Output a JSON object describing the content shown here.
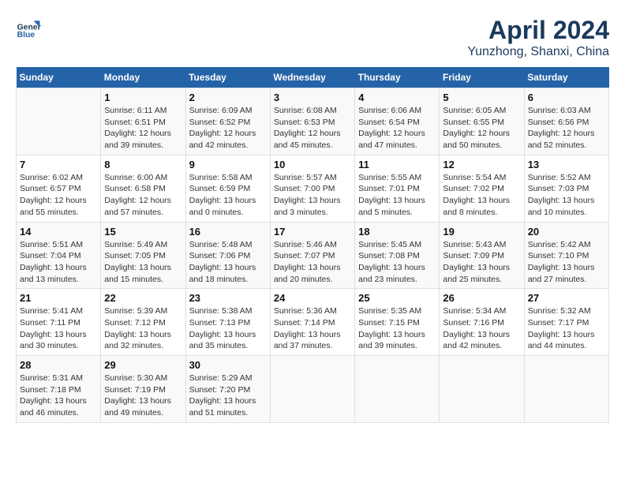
{
  "header": {
    "logo_line1": "General",
    "logo_line2": "Blue",
    "title": "April 2024",
    "subtitle": "Yunzhong, Shanxi, China"
  },
  "weekdays": [
    "Sunday",
    "Monday",
    "Tuesday",
    "Wednesday",
    "Thursday",
    "Friday",
    "Saturday"
  ],
  "rows": [
    [
      {
        "day": "",
        "info": ""
      },
      {
        "day": "1",
        "info": "Sunrise: 6:11 AM\nSunset: 6:51 PM\nDaylight: 12 hours\nand 39 minutes."
      },
      {
        "day": "2",
        "info": "Sunrise: 6:09 AM\nSunset: 6:52 PM\nDaylight: 12 hours\nand 42 minutes."
      },
      {
        "day": "3",
        "info": "Sunrise: 6:08 AM\nSunset: 6:53 PM\nDaylight: 12 hours\nand 45 minutes."
      },
      {
        "day": "4",
        "info": "Sunrise: 6:06 AM\nSunset: 6:54 PM\nDaylight: 12 hours\nand 47 minutes."
      },
      {
        "day": "5",
        "info": "Sunrise: 6:05 AM\nSunset: 6:55 PM\nDaylight: 12 hours\nand 50 minutes."
      },
      {
        "day": "6",
        "info": "Sunrise: 6:03 AM\nSunset: 6:56 PM\nDaylight: 12 hours\nand 52 minutes."
      }
    ],
    [
      {
        "day": "7",
        "info": "Sunrise: 6:02 AM\nSunset: 6:57 PM\nDaylight: 12 hours\nand 55 minutes."
      },
      {
        "day": "8",
        "info": "Sunrise: 6:00 AM\nSunset: 6:58 PM\nDaylight: 12 hours\nand 57 minutes."
      },
      {
        "day": "9",
        "info": "Sunrise: 5:58 AM\nSunset: 6:59 PM\nDaylight: 13 hours\nand 0 minutes."
      },
      {
        "day": "10",
        "info": "Sunrise: 5:57 AM\nSunset: 7:00 PM\nDaylight: 13 hours\nand 3 minutes."
      },
      {
        "day": "11",
        "info": "Sunrise: 5:55 AM\nSunset: 7:01 PM\nDaylight: 13 hours\nand 5 minutes."
      },
      {
        "day": "12",
        "info": "Sunrise: 5:54 AM\nSunset: 7:02 PM\nDaylight: 13 hours\nand 8 minutes."
      },
      {
        "day": "13",
        "info": "Sunrise: 5:52 AM\nSunset: 7:03 PM\nDaylight: 13 hours\nand 10 minutes."
      }
    ],
    [
      {
        "day": "14",
        "info": "Sunrise: 5:51 AM\nSunset: 7:04 PM\nDaylight: 13 hours\nand 13 minutes."
      },
      {
        "day": "15",
        "info": "Sunrise: 5:49 AM\nSunset: 7:05 PM\nDaylight: 13 hours\nand 15 minutes."
      },
      {
        "day": "16",
        "info": "Sunrise: 5:48 AM\nSunset: 7:06 PM\nDaylight: 13 hours\nand 18 minutes."
      },
      {
        "day": "17",
        "info": "Sunrise: 5:46 AM\nSunset: 7:07 PM\nDaylight: 13 hours\nand 20 minutes."
      },
      {
        "day": "18",
        "info": "Sunrise: 5:45 AM\nSunset: 7:08 PM\nDaylight: 13 hours\nand 23 minutes."
      },
      {
        "day": "19",
        "info": "Sunrise: 5:43 AM\nSunset: 7:09 PM\nDaylight: 13 hours\nand 25 minutes."
      },
      {
        "day": "20",
        "info": "Sunrise: 5:42 AM\nSunset: 7:10 PM\nDaylight: 13 hours\nand 27 minutes."
      }
    ],
    [
      {
        "day": "21",
        "info": "Sunrise: 5:41 AM\nSunset: 7:11 PM\nDaylight: 13 hours\nand 30 minutes."
      },
      {
        "day": "22",
        "info": "Sunrise: 5:39 AM\nSunset: 7:12 PM\nDaylight: 13 hours\nand 32 minutes."
      },
      {
        "day": "23",
        "info": "Sunrise: 5:38 AM\nSunset: 7:13 PM\nDaylight: 13 hours\nand 35 minutes."
      },
      {
        "day": "24",
        "info": "Sunrise: 5:36 AM\nSunset: 7:14 PM\nDaylight: 13 hours\nand 37 minutes."
      },
      {
        "day": "25",
        "info": "Sunrise: 5:35 AM\nSunset: 7:15 PM\nDaylight: 13 hours\nand 39 minutes."
      },
      {
        "day": "26",
        "info": "Sunrise: 5:34 AM\nSunset: 7:16 PM\nDaylight: 13 hours\nand 42 minutes."
      },
      {
        "day": "27",
        "info": "Sunrise: 5:32 AM\nSunset: 7:17 PM\nDaylight: 13 hours\nand 44 minutes."
      }
    ],
    [
      {
        "day": "28",
        "info": "Sunrise: 5:31 AM\nSunset: 7:18 PM\nDaylight: 13 hours\nand 46 minutes."
      },
      {
        "day": "29",
        "info": "Sunrise: 5:30 AM\nSunset: 7:19 PM\nDaylight: 13 hours\nand 49 minutes."
      },
      {
        "day": "30",
        "info": "Sunrise: 5:29 AM\nSunset: 7:20 PM\nDaylight: 13 hours\nand 51 minutes."
      },
      {
        "day": "",
        "info": ""
      },
      {
        "day": "",
        "info": ""
      },
      {
        "day": "",
        "info": ""
      },
      {
        "day": "",
        "info": ""
      }
    ]
  ]
}
